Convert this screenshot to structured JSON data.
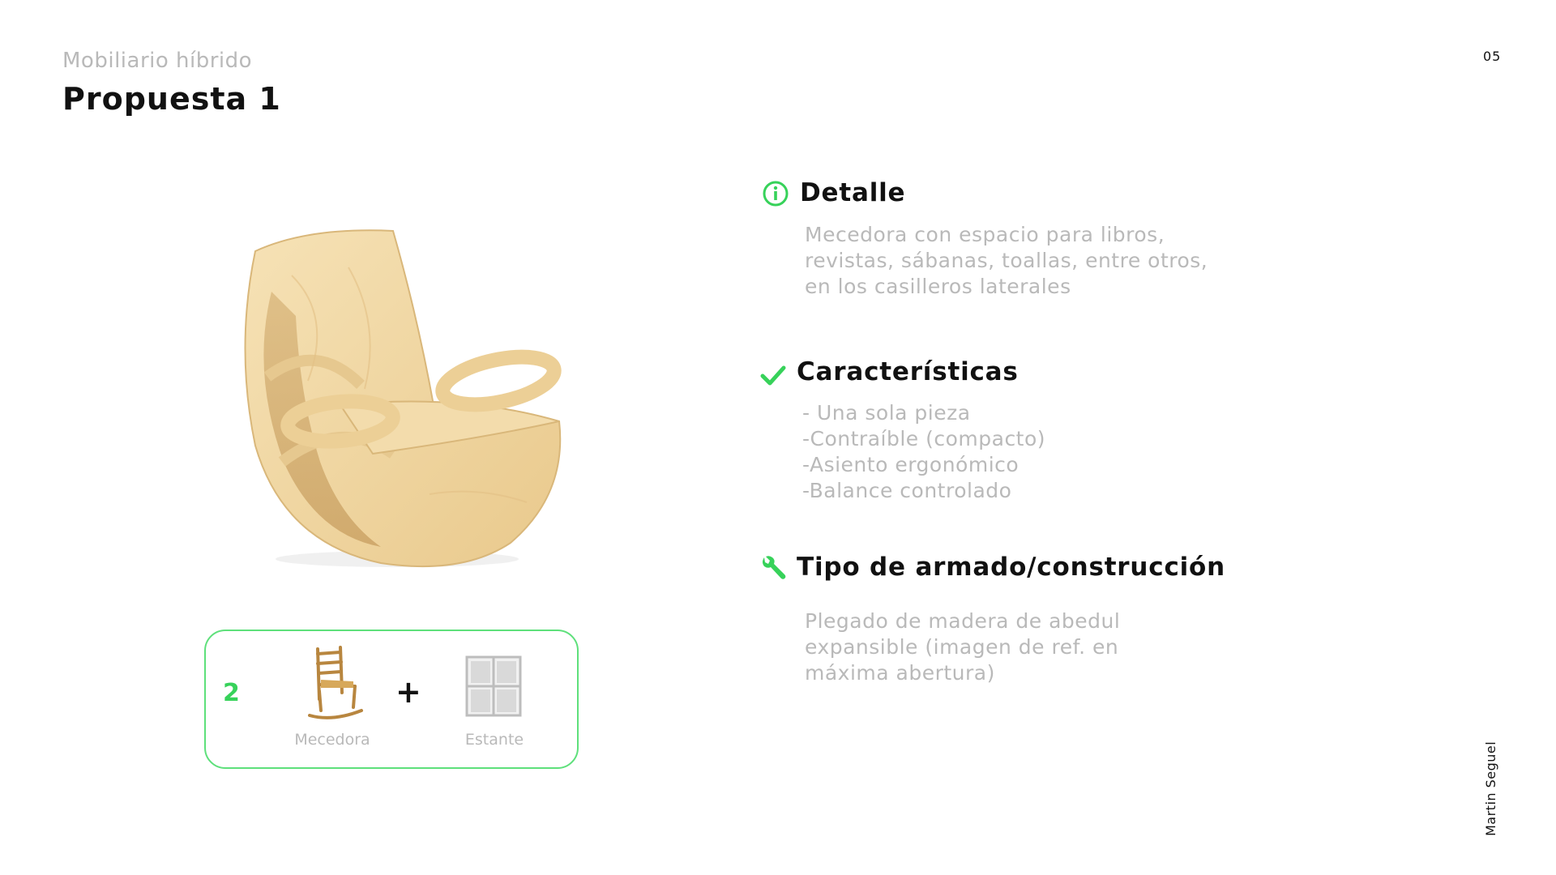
{
  "header": {
    "kicker": "Mobiliario híbrido",
    "title": "Propuesta 1",
    "page_number": "05"
  },
  "author": "Martin Seguel",
  "combo": {
    "number": "2",
    "plus": "+",
    "item1_caption": "Mecedora",
    "item2_caption": "Estante"
  },
  "sections": [
    {
      "icon": "info-icon",
      "title": "Detalle",
      "lines": [
        "Mecedora con espacio para libros,",
        "revistas, sábanas, toallas, entre otros,",
        "en los casilleros laterales"
      ]
    },
    {
      "icon": "check-icon",
      "title": "Características",
      "lines": [
        "- Una sola pieza",
        "-Contraíble (compacto)",
        "-Asiento ergonómico",
        "-Balance controlado"
      ]
    },
    {
      "icon": "wrench-icon",
      "title": "Tipo de armado/construcción",
      "lines": [
        "Plegado de madera de abedul",
        "expansible (imagen de ref. en",
        "máxima abertura)"
      ]
    }
  ],
  "colors": {
    "accent": "#37d25a",
    "muted_text": "#b9b9b9",
    "wood": "#f2d9a6"
  }
}
